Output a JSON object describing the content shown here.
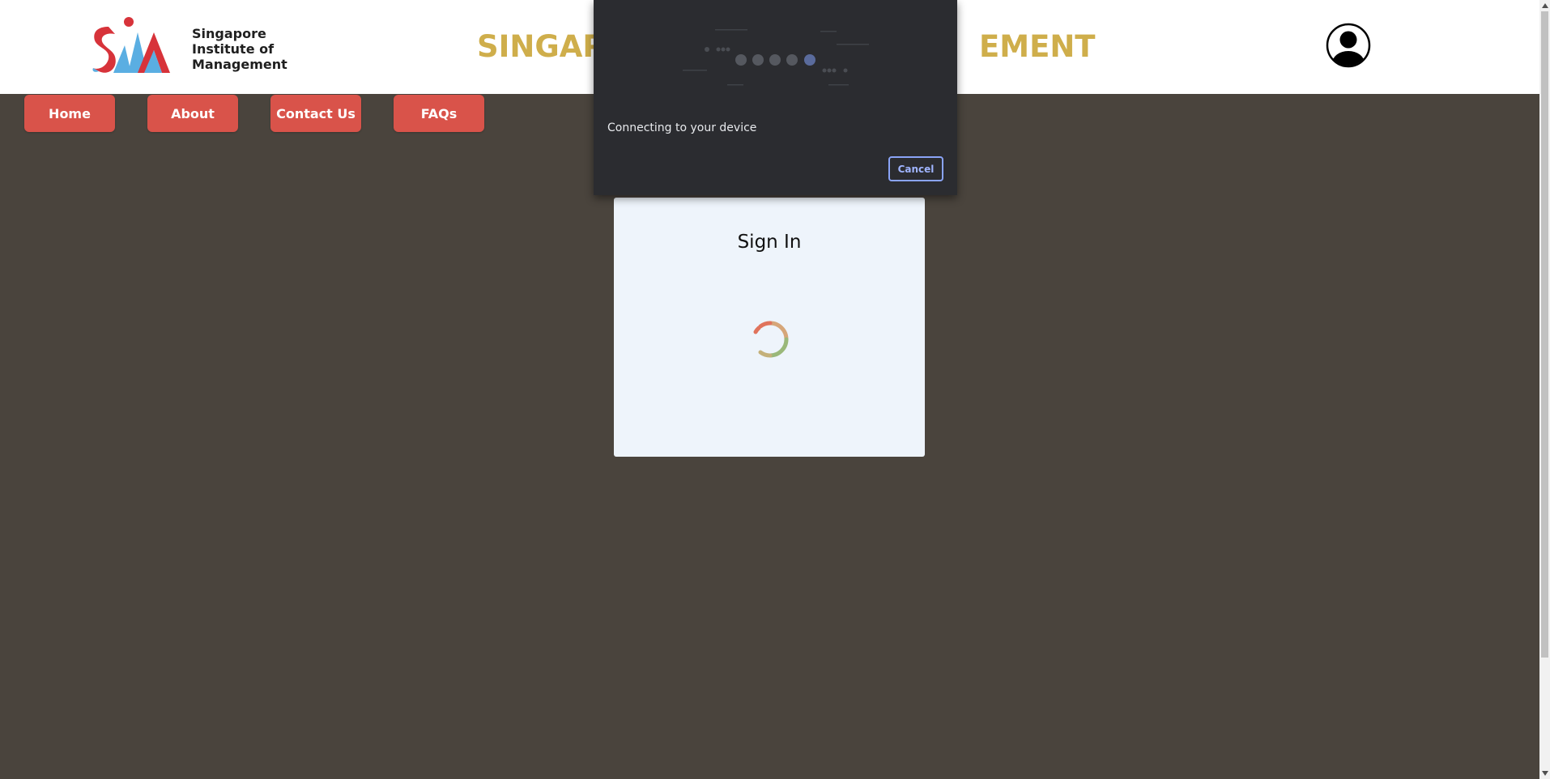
{
  "header": {
    "logo_text_lines": [
      "Singapore",
      "Institute of",
      "Management"
    ],
    "title_left": "SINGAPO",
    "title_right": "EMENT",
    "colors": {
      "title": "#cfae4b",
      "logo_red": "#d7333a",
      "logo_blue": "#5aaee2"
    }
  },
  "nav": {
    "items": [
      {
        "label": "Home"
      },
      {
        "label": "About"
      },
      {
        "label": "Contact Us"
      },
      {
        "label": "FAQs"
      }
    ],
    "color": "#d9534a"
  },
  "signin": {
    "title": "Sign In"
  },
  "device_dialog": {
    "message": "Connecting to your device",
    "cancel_label": "Cancel"
  }
}
